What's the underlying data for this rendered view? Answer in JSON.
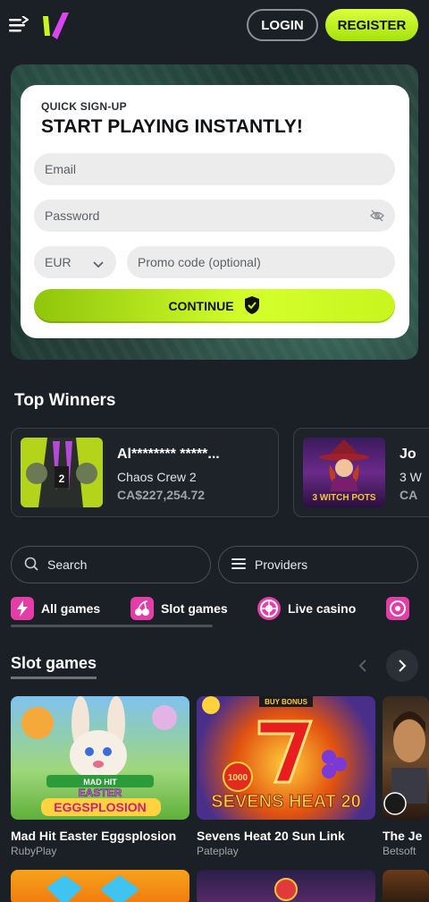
{
  "header": {
    "login_label": "LOGIN",
    "register_label": "REGISTER"
  },
  "signup": {
    "kicker": "QUICK SIGN-UP",
    "title": "START PLAYING INSTANTLY!",
    "email_placeholder": "Email",
    "password_placeholder": "Password",
    "currency": "EUR",
    "promo_placeholder": "Promo code (optional)",
    "continue_label": "CONTINUE"
  },
  "top_winners": {
    "title": "Top Winners",
    "items": [
      {
        "name": "Al******** *****...",
        "game": "Chaos Crew 2",
        "amount": "CA$227,254.72"
      },
      {
        "name": "Jo",
        "game": "3 W",
        "amount": "CA"
      }
    ]
  },
  "filters": {
    "search_label": "Search",
    "providers_label": "Providers"
  },
  "categories": [
    {
      "label": "All games",
      "icon": "flame-bolt-icon"
    },
    {
      "label": "Slot games",
      "icon": "cherry-icon"
    },
    {
      "label": "Live casino",
      "icon": "roulette-icon"
    },
    {
      "label": "",
      "icon": "poker-chip-icon"
    }
  ],
  "slot_games": {
    "title": "Slot games",
    "items": [
      {
        "title": "Mad Hit Easter Eggsplosion",
        "provider": "RubyPlay"
      },
      {
        "title": "Sevens Heat 20 Sun Link",
        "provider": "Pateplay"
      },
      {
        "title": "The Je",
        "provider": "Betsoft"
      }
    ]
  },
  "thumb_text": {
    "witch": "3 WITCH POTS",
    "sevens_badge": "BUY BONUS",
    "sevens_num": "1000",
    "sevens_name": "SEVENS HEAT 20",
    "easter_top": "MAD HIT",
    "easter_mid": "EASTER",
    "easter_bottom": "EGGSPLOSION"
  },
  "colors": {
    "accent": "#c7f51e",
    "background": "#1b1f26",
    "card": "#ffffff"
  }
}
